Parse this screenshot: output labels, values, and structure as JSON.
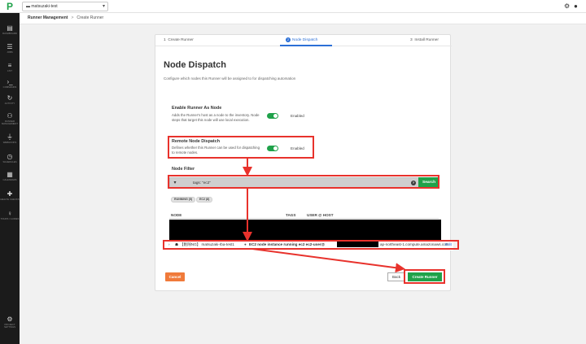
{
  "topbar": {
    "logo": "P",
    "project": "matsuzaki-test",
    "project_icon": "folder-icon",
    "gear_glyph": "⚙",
    "user_glyph": "●"
  },
  "sidebar": {
    "items": [
      {
        "icon": "clipboard-icon",
        "glyph": "▤",
        "label": "DASHBOARD"
      },
      {
        "icon": "list-icon",
        "glyph": "☰",
        "label": "JOBS"
      },
      {
        "icon": "terminal-list-icon",
        "glyph": "≡",
        "label": "LIST"
      },
      {
        "icon": "prompt-icon",
        "glyph": "›_",
        "label": "COMMANDS"
      },
      {
        "icon": "history-icon",
        "glyph": "↻",
        "label": "ACTIVITY"
      },
      {
        "icon": "network-icon",
        "glyph": "⚇",
        "label": "RUNNER MANAGEMENT"
      },
      {
        "icon": "plug-icon",
        "glyph": "⏚",
        "label": "WEBHOOKS"
      },
      {
        "icon": "clock-icon",
        "glyph": "◷",
        "label": "SCHEDULES"
      },
      {
        "icon": "calendar-icon",
        "glyph": "▦",
        "label": "CALENDARS"
      },
      {
        "icon": "health-icon",
        "glyph": "✚",
        "label": "HEALTH CHECKS"
      },
      {
        "icon": "lightbulb-icon",
        "glyph": "♀",
        "label": "TOURS / GUIDES"
      },
      {
        "icon": "settings-icon",
        "glyph": "⚙",
        "label": "PROJECT SETTINGS"
      }
    ]
  },
  "breadcrumb": {
    "parent": "Runner Management",
    "separator": ">",
    "current": "Create Runner"
  },
  "stepper": {
    "steps": [
      {
        "num": "1",
        "label": "Create Runner"
      },
      {
        "num": "2",
        "label": "Node Dispatch"
      },
      {
        "num": "3",
        "label": "Install Runner"
      }
    ]
  },
  "page": {
    "title": "Node Dispatch",
    "subtitle": "Configure which nodes this Runner will be assigned to for dispatching automation"
  },
  "options": {
    "runner_as_node": {
      "title": "Enable Runner As Node",
      "description": "Adds the Runner's host as a node to the inventory. Node steps that target this node will use local execution.",
      "enabled": true,
      "state_label": "Enabled"
    },
    "remote_dispatch": {
      "title": "Remote Node Dispatch",
      "description": "Defines whether this Runner can be used for dispatching to remote nodes.",
      "enabled": true,
      "state_label": "Enabled"
    }
  },
  "filter": {
    "section_label": "Node Filter",
    "menu_glyph": "▾",
    "value": "tags: \"ec2\"",
    "info_glyph": "?",
    "search_label": "Search",
    "chips": [
      "RUNNING (5)",
      "EC2 (8)"
    ]
  },
  "table": {
    "headers": {
      "node": "NODE",
      "tags": "TAGS",
      "user_host": "USER @ HOST"
    },
    "row": {
      "node_text": "【削除NG】 matsuzaki-rba-test1",
      "tags_text": "EC2 node instance running ec2 ec2-user@",
      "host_suffix": "ap-northeast-1.compute.amazonaws.com",
      "edit_label": "Edit"
    }
  },
  "actions": {
    "cancel": "Cancel",
    "back": "Back",
    "create": "Create Runner"
  },
  "colors": {
    "accent_green": "#1fa24a",
    "step_blue": "#2b6fd6",
    "cancel_orange": "#f07a3a",
    "annotation_red": "#e8322c"
  }
}
